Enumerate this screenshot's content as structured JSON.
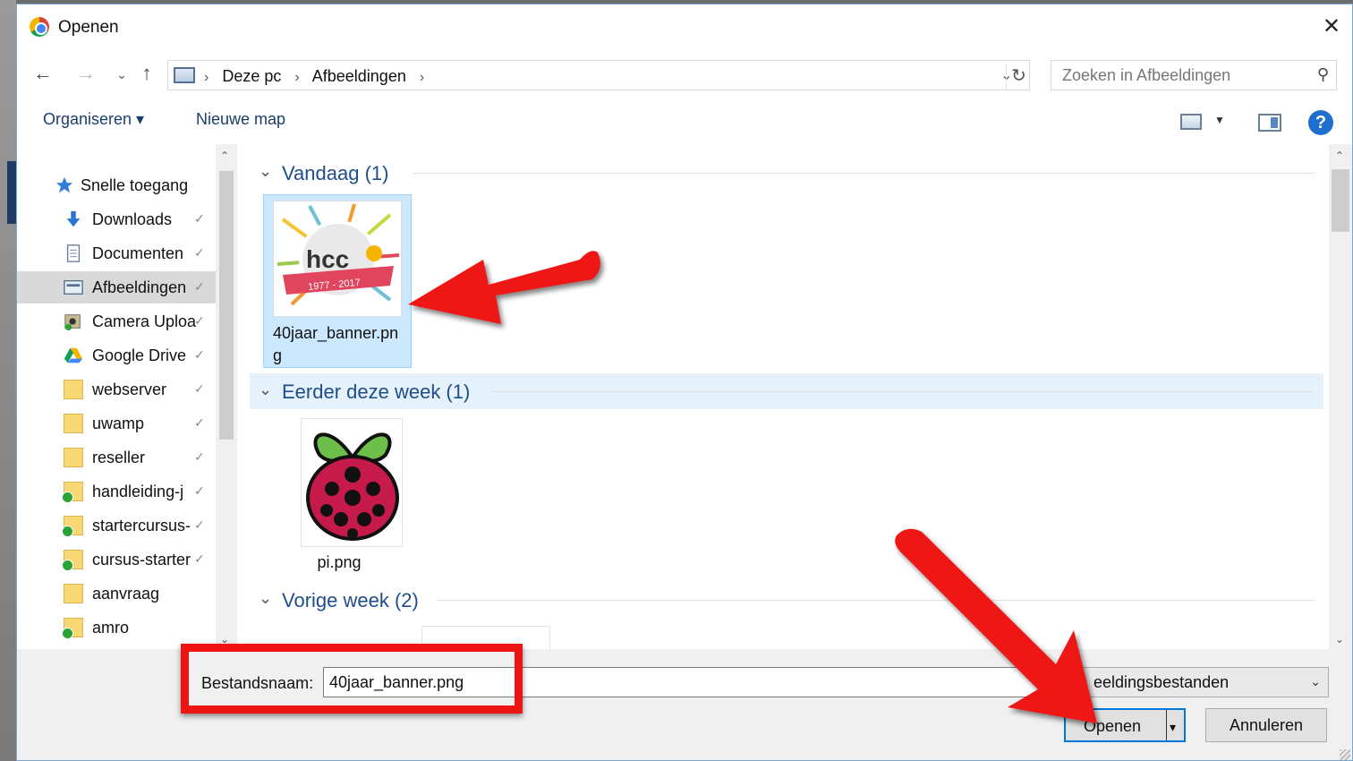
{
  "window": {
    "title": "Openen",
    "close_glyph": "✕"
  },
  "nav": {
    "back": "←",
    "forward": "→",
    "history": "⌄",
    "up": "↑",
    "refresh": "↻"
  },
  "address": {
    "crumbs": [
      "Deze pc",
      "Afbeeldingen"
    ],
    "separator": "›",
    "dropdown": "⌄",
    "search_placeholder": "Zoeken in Afbeeldingen",
    "search_glyph": "⚲"
  },
  "toolbar": {
    "organize": "Organiseren ▾",
    "new_folder": "Nieuwe map",
    "view_drop": "▼",
    "help": "?"
  },
  "sidebar": {
    "quick_access": "Snelle toegang",
    "items": [
      {
        "label": "Downloads",
        "icon": "download-icon",
        "pinned": true
      },
      {
        "label": "Documenten",
        "icon": "document-icon",
        "pinned": true
      },
      {
        "label": "Afbeeldingen",
        "icon": "pictures-icon",
        "pinned": true,
        "selected": true
      },
      {
        "label": "Camera Uploads",
        "icon": "camera-icon",
        "pinned": true
      },
      {
        "label": "Google Drive",
        "icon": "google-drive-icon",
        "pinned": true
      },
      {
        "label": "webserver",
        "icon": "folder-icon",
        "pinned": true
      },
      {
        "label": "uwamp",
        "icon": "folder-icon",
        "pinned": true
      },
      {
        "label": "reseller",
        "icon": "folder-icon",
        "pinned": true
      },
      {
        "label": "handleiding-j",
        "icon": "synced-folder-icon",
        "pinned": true
      },
      {
        "label": "startercursus-",
        "icon": "synced-folder-icon",
        "pinned": true
      },
      {
        "label": "cursus-starter",
        "icon": "shared-folder-icon",
        "pinned": true
      },
      {
        "label": "aanvraag",
        "icon": "folder-icon",
        "pinned": false
      },
      {
        "label": "amro",
        "icon": "synced-folder-icon",
        "pinned": false
      }
    ],
    "pin_glyph": "✓"
  },
  "groups": [
    {
      "label": "Vandaag (1)",
      "chevron": "⌄"
    },
    {
      "label": "Eerder deze week (1)",
      "chevron": "⌄"
    },
    {
      "label": "Vorige week (2)",
      "chevron": "⌄"
    }
  ],
  "files": [
    {
      "name": "40jaar_banner.png",
      "thumb_text": "hcc",
      "thumb_years": "1977 - 2017",
      "selected": true
    },
    {
      "name": "pi.png",
      "selected": false
    }
  ],
  "footer": {
    "filename_label": "Bestandsnaam:",
    "filename_value": "40jaar_banner.png",
    "filetype_value": "eeldingsbestanden",
    "filetype_drop": "⌄",
    "open_button": "Openen",
    "open_drop": "▾",
    "cancel_button": "Annuleren"
  },
  "scroll": {
    "up": "⌃",
    "down": "⌄"
  },
  "colors": {
    "annotation_red": "#ef1414",
    "accent": "#0078d7",
    "group_blue": "#1e4d8c"
  }
}
